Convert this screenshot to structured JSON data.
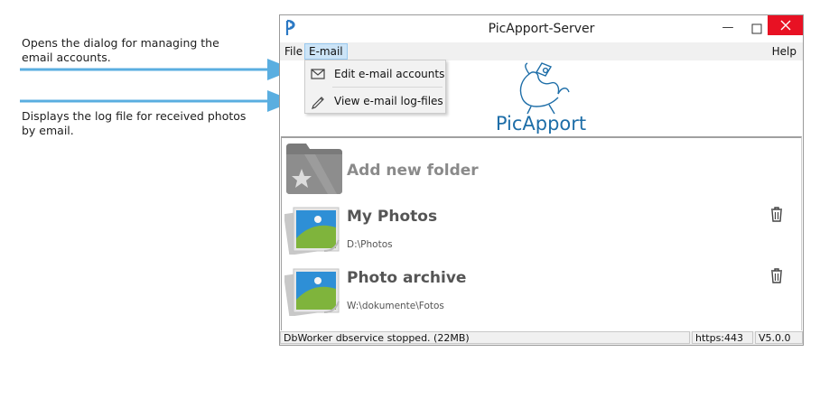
{
  "annotations": {
    "edit_accounts": "Opens the dialog for managing the email accounts.",
    "view_logs": "Displays the log file for received photos by email."
  },
  "window": {
    "title": "PicApport-Server",
    "controls": {
      "minimize": "—",
      "maximize": "☐",
      "close": "✕"
    }
  },
  "menu": {
    "file": "File",
    "email": "E-mail",
    "help": "Help"
  },
  "email_menu": {
    "items": [
      {
        "label": "Edit e-mail accounts",
        "icon": "envelope-icon"
      },
      {
        "label": "View e-mail log-files",
        "icon": "pencil-icon"
      }
    ]
  },
  "logo": {
    "text": "PicApport"
  },
  "folders": {
    "add_label": "Add new folder",
    "items": [
      {
        "name": "My Photos",
        "path": "D:\\Photos"
      },
      {
        "name": "Photo archive",
        "path": "W:\\dokumente\\Fotos"
      }
    ]
  },
  "status": {
    "message": "DbWorker dbservice stopped. (22MB)",
    "port": "https:443",
    "version": "V5.0.0"
  },
  "colors": {
    "arrow": "#5aaee0",
    "close_button": "#e81123",
    "menu_highlight": "#cce4f7",
    "logo_blue": "#1e6ea8"
  }
}
